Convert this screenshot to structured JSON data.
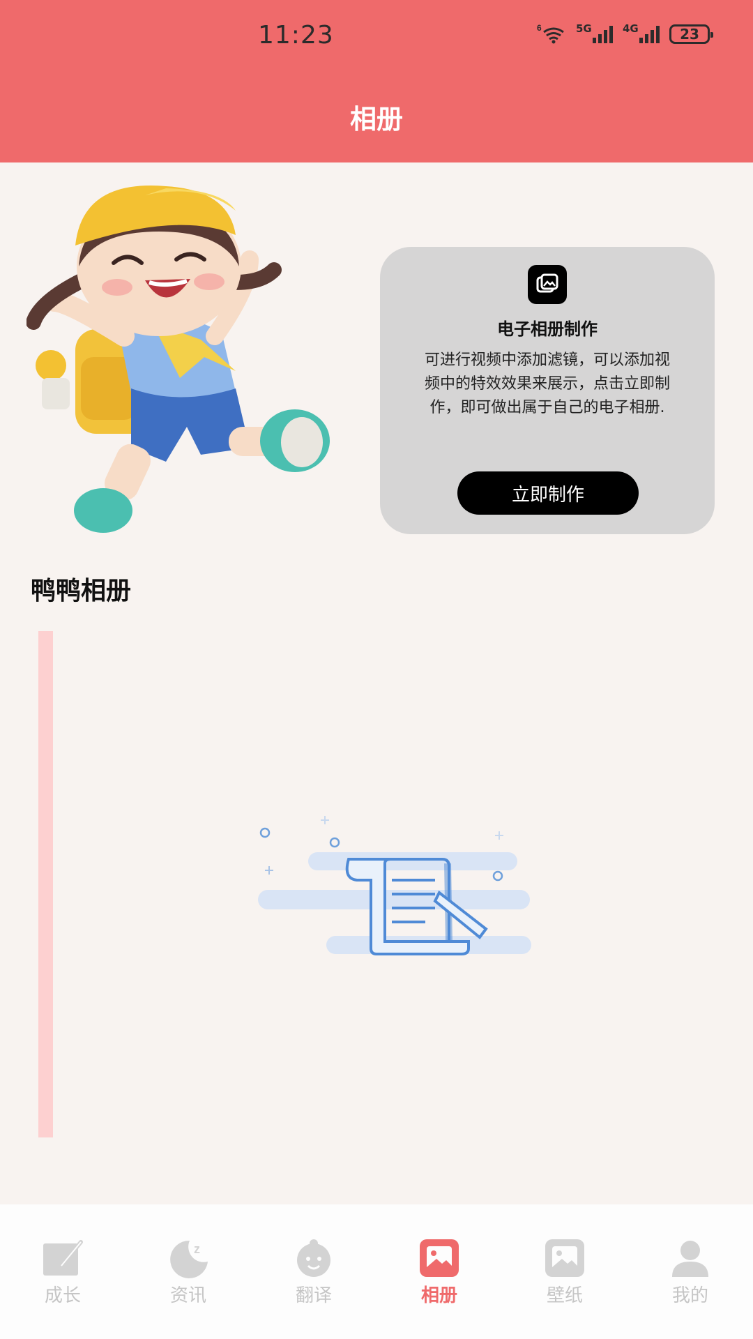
{
  "status_bar": {
    "time": "11:23",
    "wifi_label": "6",
    "signal_1_label": "5G",
    "signal_2_label": "4G",
    "battery": "23"
  },
  "header": {
    "title": "相册"
  },
  "promo": {
    "icon": "photo-album-icon",
    "title": "电子相册制作",
    "description": "可进行视频中添加滤镜，可以添加视频中的特效效果来展示，点击立即制作，即可做出属于自己的电子相册.",
    "button_label": "立即制作"
  },
  "section": {
    "title": "鸭鸭相册"
  },
  "empty_state": {
    "icon": "empty-document-icon"
  },
  "bottom_nav": {
    "items": [
      {
        "label": "成长",
        "icon": "pen-note-icon",
        "active": false
      },
      {
        "label": "资讯",
        "icon": "moon-icon",
        "active": false
      },
      {
        "label": "翻译",
        "icon": "baby-face-icon",
        "active": false
      },
      {
        "label": "相册",
        "icon": "image-icon",
        "active": true
      },
      {
        "label": "壁纸",
        "icon": "picture-icon",
        "active": false
      },
      {
        "label": "我的",
        "icon": "user-icon",
        "active": false
      }
    ],
    "active_color": "#ef6a6b",
    "inactive_color": "#c5c5c5"
  },
  "colors": {
    "header": "#ef6a6b",
    "background": "#f8f3f0",
    "accent_bar": "#fdd0d0",
    "card": "#d6d5d5"
  }
}
